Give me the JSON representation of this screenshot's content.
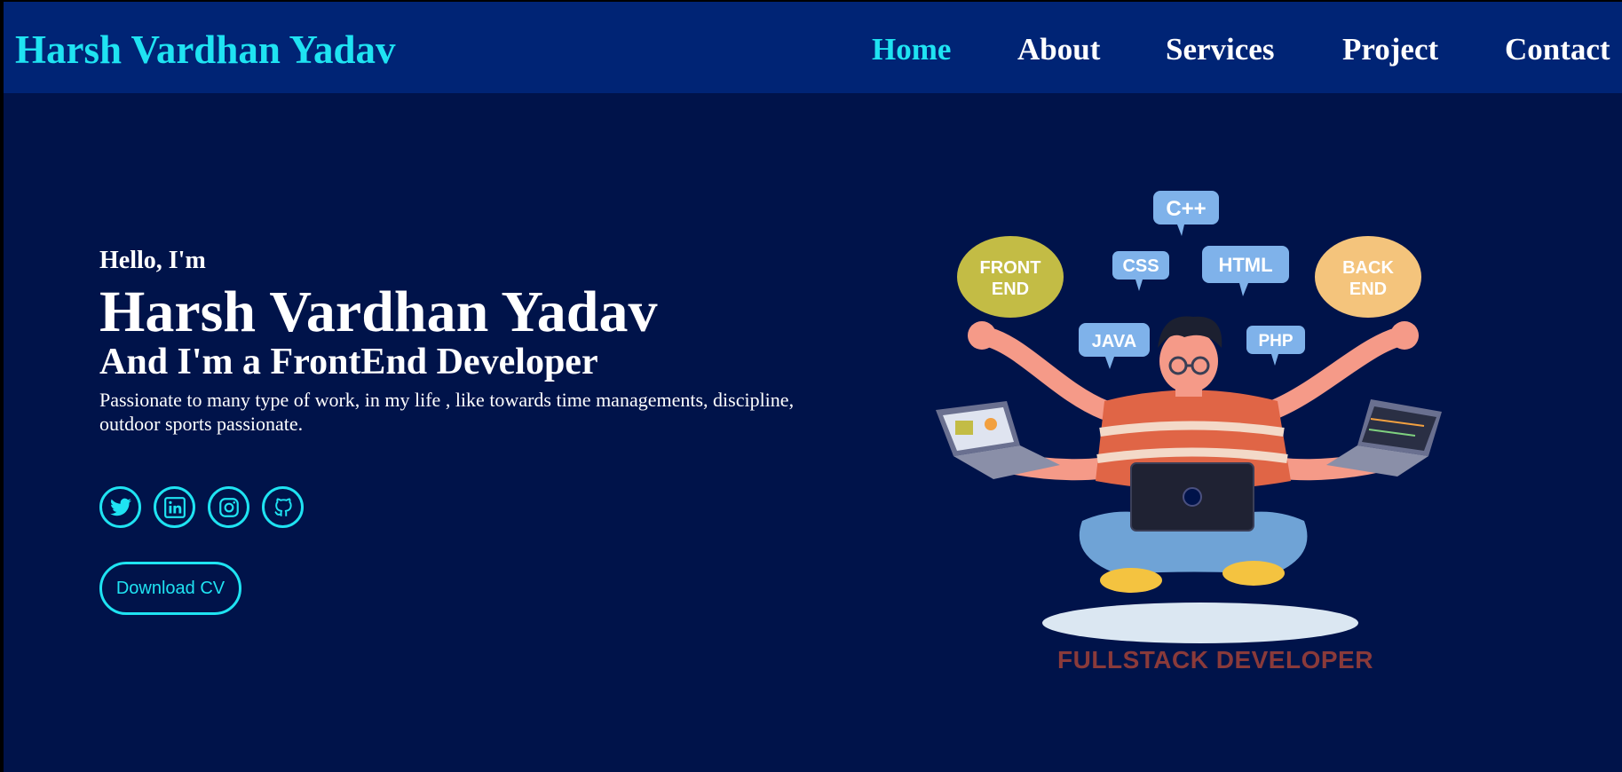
{
  "header": {
    "logo": "Harsh Vardhan Yadav",
    "nav": [
      {
        "label": "Home",
        "active": true
      },
      {
        "label": "About",
        "active": false
      },
      {
        "label": "Services",
        "active": false
      },
      {
        "label": "Project",
        "active": false
      },
      {
        "label": "Contact",
        "active": false
      }
    ]
  },
  "hero": {
    "greeting": "Hello, I'm",
    "name": "Harsh Vardhan Yadav",
    "role": "And I'm a FrontEnd Developer",
    "description": "Passionate to many type of work, in my life , like towards time managements, discipline, outdoor sports passionate.",
    "socials": [
      {
        "icon": "twitter-icon"
      },
      {
        "icon": "linkedin-icon"
      },
      {
        "icon": "instagram-icon"
      },
      {
        "icon": "github-icon"
      }
    ],
    "cv_button": "Download CV"
  },
  "illustration": {
    "bubbles": {
      "cpp": "C++",
      "css": "CSS",
      "html": "HTML",
      "java": "JAVA",
      "php": "PHP",
      "front_line1": "FRONT",
      "front_line2": "END",
      "back_line1": "BACK",
      "back_line2": "END"
    },
    "caption": "FULLSTACK DEVELOPER"
  },
  "colors": {
    "accent": "#1fe3f2",
    "navbar_bg": "#002475",
    "page_bg": "#00134a",
    "text": "#ffffff"
  }
}
